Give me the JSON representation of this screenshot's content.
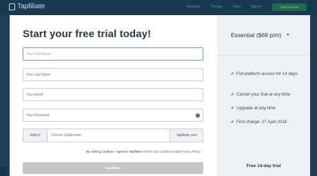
{
  "header": {
    "logo_text": "Tapfiliate",
    "nav": [
      "Features",
      "Pricing",
      "Docs",
      "Sign in"
    ],
    "cta": "Start free trial"
  },
  "form": {
    "title": "Start your free trial today!",
    "first_name_placeholder": "Your First Name",
    "last_name_placeholder": "Your Last Name",
    "email_placeholder": "Your Email",
    "password_placeholder": "Your Password",
    "subdomain_prefix": "https://",
    "subdomain_placeholder": "Choose Subdomain",
    "subdomain_suffix": ".tapfiliate.com",
    "terms_prefix": "By clicking continue, I agree to Tapfiliate's",
    "terms_link": "Terms and Conditions",
    "terms_and": "and",
    "privacy_link": "Privacy Policy",
    "continue_label": "Continue"
  },
  "plan_panel": {
    "plan_label": "Essential ($69 p/m)",
    "features": [
      "Full platform access for 14 days",
      "Cancel your trial at any time",
      "Upgrade at any time",
      "First charge: 27 April 2018"
    ],
    "free_trial_label": "Free 14-day trial"
  }
}
